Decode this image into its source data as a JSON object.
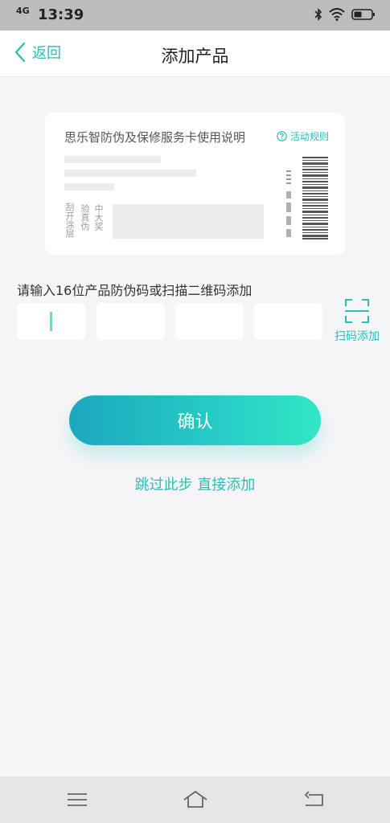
{
  "status_bar": {
    "network": "4G",
    "time": "13:39",
    "icons": [
      "bluetooth-icon",
      "wifi-icon",
      "battery-icon"
    ]
  },
  "header": {
    "back_label": "返回",
    "title": "添加产品"
  },
  "card": {
    "title": "思乐智防伪及保修服务卡使用说明",
    "rules_label": "活动规则",
    "scratch_hint": "刮开涂层",
    "verify_hint": "验真伪",
    "prize_hint": "中大奖"
  },
  "form": {
    "instruction": "请输入16位产品防伪码或扫描二维码添加",
    "code_segments": [
      "",
      "",
      "",
      ""
    ],
    "scan_label": "扫码添加"
  },
  "actions": {
    "confirm_label": "确认",
    "skip_label": "跳过此步 直接添加"
  },
  "colors": {
    "accent": "#2bbdb5",
    "gradient_start": "#1ca8bd",
    "gradient_end": "#32e6c5"
  }
}
